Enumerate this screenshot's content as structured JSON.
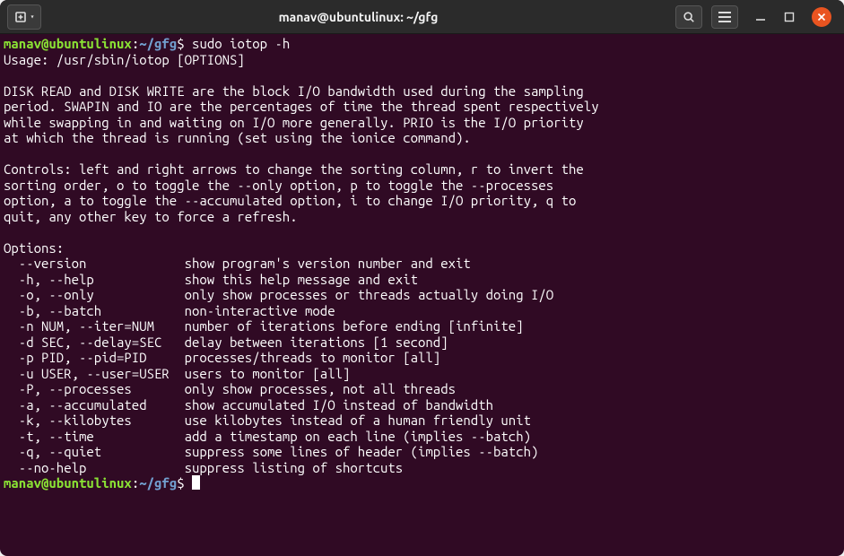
{
  "titlebar": {
    "title": "manav@ubuntulinux: ~/gfg"
  },
  "prompt": {
    "user_host": "manav@ubuntulinux",
    "separator": ":",
    "path": "~/gfg",
    "symbol": "$"
  },
  "command1": "sudo iotop -h",
  "output": {
    "usage": "Usage: /usr/sbin/iotop [OPTIONS]",
    "desc1": "DISK READ and DISK WRITE are the block I/O bandwidth used during the sampling",
    "desc2": "period. SWAPIN and IO are the percentages of time the thread spent respectively",
    "desc3": "while swapping in and waiting on I/O more generally. PRIO is the I/O priority",
    "desc4": "at which the thread is running (set using the ionice command).",
    "ctrl1": "Controls: left and right arrows to change the sorting column, r to invert the",
    "ctrl2": "sorting order, o to toggle the --only option, p to toggle the --processes",
    "ctrl3": "option, a to toggle the --accumulated option, i to change I/O priority, q to",
    "ctrl4": "quit, any other key to force a refresh.",
    "opts_header": "Options:",
    "opt_version": "  --version             show program's version number and exit",
    "opt_help": "  -h, --help            show this help message and exit",
    "opt_only": "  -o, --only            only show processes or threads actually doing I/O",
    "opt_batch": "  -b, --batch           non-interactive mode",
    "opt_iter": "  -n NUM, --iter=NUM    number of iterations before ending [infinite]",
    "opt_delay": "  -d SEC, --delay=SEC   delay between iterations [1 second]",
    "opt_pid": "  -p PID, --pid=PID     processes/threads to monitor [all]",
    "opt_user": "  -u USER, --user=USER  users to monitor [all]",
    "opt_processes": "  -P, --processes       only show processes, not all threads",
    "opt_accumulated": "  -a, --accumulated     show accumulated I/O instead of bandwidth",
    "opt_kilobytes": "  -k, --kilobytes       use kilobytes instead of a human friendly unit",
    "opt_time": "  -t, --time            add a timestamp on each line (implies --batch)",
    "opt_quiet": "  -q, --quiet           suppress some lines of header (implies --batch)",
    "opt_nohelp": "  --no-help             suppress listing of shortcuts"
  }
}
